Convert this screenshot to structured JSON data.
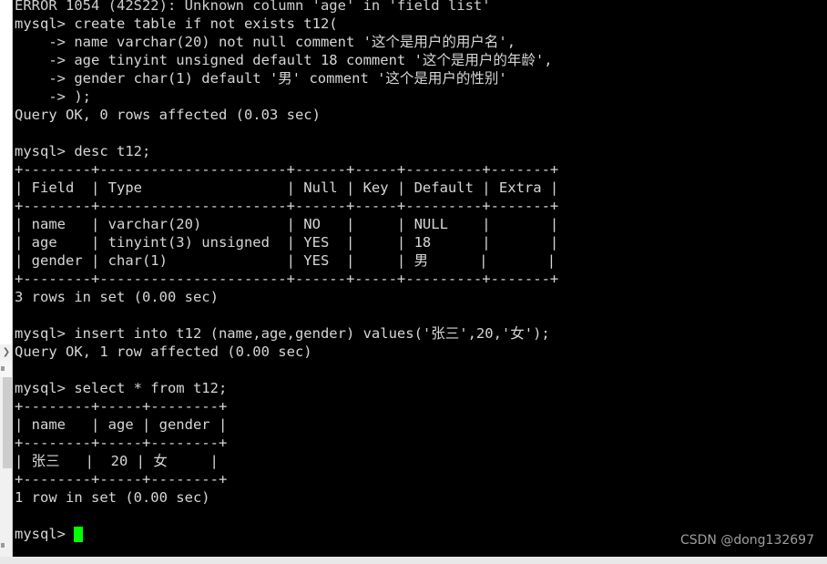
{
  "terminal": {
    "prompt": "mysql> ",
    "continuation": "    -> ",
    "lines": [
      "ERROR 1054 (42S22): Unknown column 'age' in 'field list'",
      "mysql> create table if not exists t12(",
      "    -> name varchar(20) not null comment '这个是用户的用户名',",
      "    -> age tinyint unsigned default 18 comment '这个是用户的年龄',",
      "    -> gender char(1) default '男' comment '这个是用户的性别'",
      "    -> );",
      "Query OK, 0 rows affected (0.03 sec)",
      "",
      "mysql> desc t12;",
      "+--------+----------------------+------+-----+---------+-------+",
      "| Field  | Type                 | Null | Key | Default | Extra |",
      "+--------+----------------------+------+-----+---------+-------+",
      "| name   | varchar(20)          | NO   |     | NULL    |       |",
      "| age    | tinyint(3) unsigned  | YES  |     | 18      |       |",
      "| gender | char(1)              | YES  |     | 男      |       |",
      "+--------+----------------------+------+-----+---------+-------+",
      "3 rows in set (0.00 sec)",
      "",
      "mysql> insert into t12 (name,age,gender) values('张三',20,'女');",
      "Query OK, 1 row affected (0.00 sec)",
      "",
      "mysql> select * from t12;",
      "+--------+-----+--------+",
      "| name   | age | gender |",
      "+--------+-----+--------+",
      "| 张三   |  20 | 女     |",
      "+--------+-----+--------+",
      "1 row in set (0.00 sec)",
      "",
      "mysql> "
    ],
    "cursor_prompt": "mysql> "
  },
  "desc_table": {
    "headers": [
      "Field",
      "Type",
      "Null",
      "Key",
      "Default",
      "Extra"
    ],
    "rows": [
      [
        "name",
        "varchar(20)",
        "NO",
        "",
        "NULL",
        ""
      ],
      [
        "age",
        "tinyint(3) unsigned",
        "YES",
        "",
        "18",
        ""
      ],
      [
        "gender",
        "char(1)",
        "YES",
        "",
        "男",
        ""
      ]
    ],
    "footer": "3 rows in set (0.00 sec)"
  },
  "select_table": {
    "headers": [
      "name",
      "age",
      "gender"
    ],
    "rows": [
      [
        "张三",
        "20",
        "女"
      ]
    ],
    "footer": "1 row in set (0.00 sec)"
  },
  "scrollbar": {
    "arrow_glyph": "❯"
  },
  "watermark": {
    "text": "CSDN @dong132697"
  },
  "colors": {
    "background": "#000000",
    "text": "#d6d6d6",
    "cursor": "#00ff00",
    "watermark": "#9e9e9e",
    "scrollbar_track": "#f1f1f1",
    "scrollbar_thumb": "#cdcdcd"
  }
}
